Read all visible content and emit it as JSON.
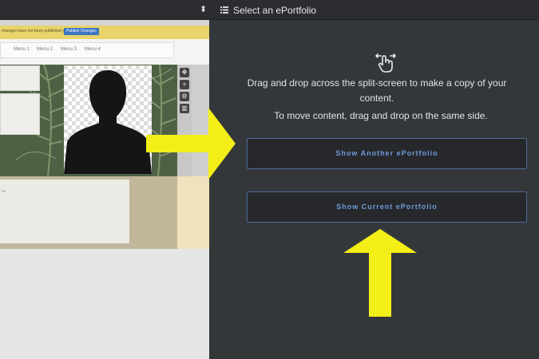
{
  "header": {
    "title": "Select an ePortfolio",
    "title_icon": "list-icon",
    "left_select_icon": "updown-chevron-icon"
  },
  "editor_preview": {
    "notice_text": "changes have not been published yet.",
    "publish_button": "Publish Changes",
    "menu_items": [
      "Menu 1",
      "Menu 2",
      "Menu 3",
      "Menu 4"
    ],
    "toolbar_icons": [
      "move-icon",
      "plus-icon",
      "gear-icon",
      "trash-icon"
    ]
  },
  "split_screen": {
    "drag_icon": "drag-gesture-icon",
    "instruction_copy": "Drag and drop across the split-screen to make a copy of your content.",
    "instruction_move": "To move content, drag and drop on the same side.",
    "show_another_button": "Show Another ePortfolio",
    "show_current_button": "Show Current ePortfolio"
  },
  "colors": {
    "accent_blue": "#6f9ad9",
    "arrow_yellow": "#f3ee17",
    "notice_yellow": "#e9d36a",
    "dark_panel": "#34373a"
  }
}
